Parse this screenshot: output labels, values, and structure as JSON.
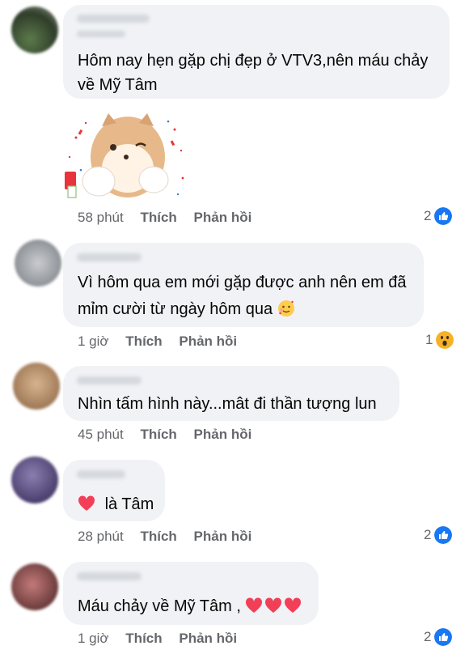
{
  "comments": [
    {
      "text_lines": [
        "Hôm nay hẹn gặp chị đẹp ở VTV3,nên máu chảy",
        "về Mỹ Tâm"
      ],
      "time": "58 phút",
      "like_label": "Thích",
      "reply_label": "Phản hồi",
      "reaction_count": "2",
      "reaction": "like-icon",
      "has_sticker": true
    },
    {
      "text_lines": [
        "Vì hôm qua em mới gặp được anh nên em đã",
        "mỉm cười từ ngày hôm qua"
      ],
      "time": "1 giờ",
      "like_label": "Thích",
      "reply_label": "Phản hồi",
      "reaction_count": "1",
      "reaction": "wow-icon"
    },
    {
      "text_lines": [
        "Nhìn tấm hình này...mât đi thần tượng lun"
      ],
      "time": "45 phút",
      "like_label": "Thích",
      "reply_label": "Phản hồi"
    },
    {
      "text_lines": [
        "là Tâm"
      ],
      "time": "28 phút",
      "like_label": "Thích",
      "reply_label": "Phản hồi",
      "reaction_count": "2",
      "reaction": "like-icon"
    },
    {
      "text_lines": [
        "Máu chảy về Mỹ Tâm ,"
      ],
      "time": "1 giờ",
      "like_label": "Thích",
      "reply_label": "Phản hồi",
      "reaction_count": "2",
      "reaction": "like-icon"
    }
  ],
  "colors": {
    "bubble": "#f0f2f5",
    "meta": "#65676b",
    "like_blue": "#1877f2",
    "heart": "#f33e58"
  }
}
